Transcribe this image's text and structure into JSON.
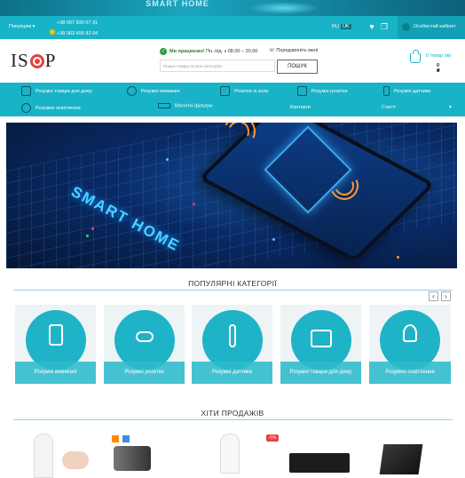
{
  "banner": {
    "text": "SMART HOME"
  },
  "topbar": {
    "buyers": "Покупцям ▾",
    "phone1": "+38 097 930 07 31",
    "phone2": "+38 063 499 92 04",
    "lang_ru": "RU",
    "lang_uk": "UK",
    "account": "Особистий кабінет"
  },
  "header": {
    "logo": "ISHOP",
    "work_label": "Ми працюємо!",
    "work_hours": "Пн.-Нд. з 08.00 – 20.00",
    "callback": "Передзвоніть мені",
    "search_placeholder": "Пошук товару по всіх категоріях",
    "search_button": "ПОШУК",
    "cart_count": "0 товар (ів)",
    "cart_sum": "0 ₴"
  },
  "nav": {
    "row1": [
      "Розумні товари для дому",
      "Розумні вимикачі",
      "Розетки зі зола",
      "Розумні розетки",
      "Розумні датчики"
    ],
    "row2": [
      "Розумне освітлення",
      "Магнітні фільтри",
      "Контакти",
      "Статті"
    ]
  },
  "popular": {
    "title": "ПОПУЛЯРНІ КАТЕГОРІЇ",
    "prev": "‹",
    "next": "›",
    "items": [
      "Розумні вимикачі",
      "Розумні розетки",
      "Розумні датчики",
      "Розумні товари для дому",
      "Розумне освітлення"
    ]
  },
  "hits": {
    "title": "ХІТИ ПРОДАЖІВ",
    "badge": "-5%"
  },
  "colors": {
    "teal": "#19b3c7",
    "accent": "#e8413e"
  }
}
